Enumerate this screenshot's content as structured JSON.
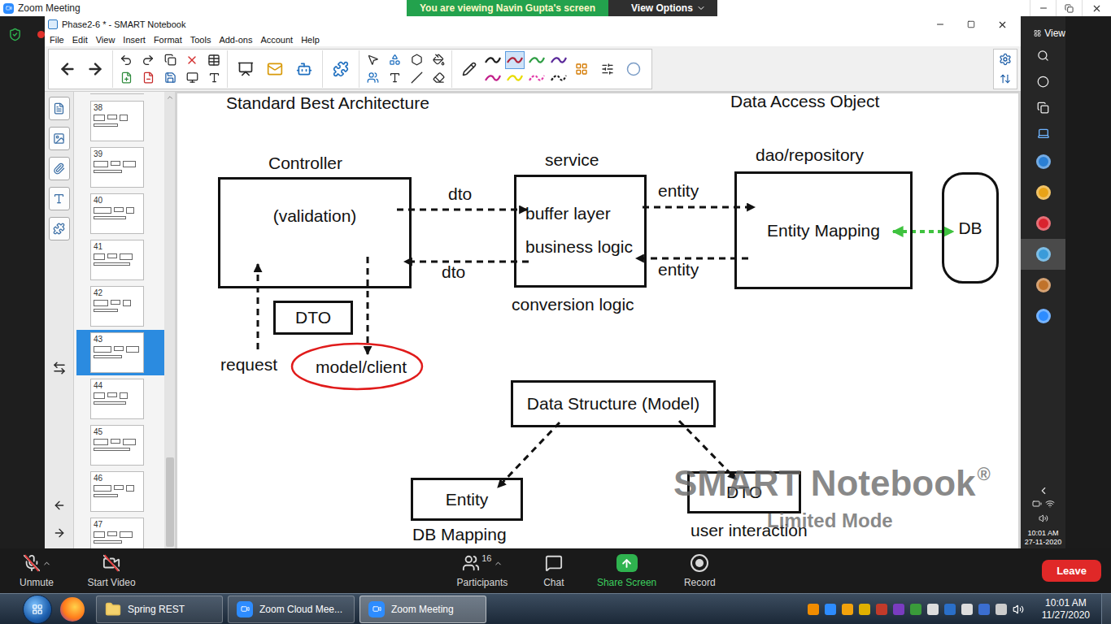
{
  "zoom_title_bar": {
    "title": "Zoom Meeting",
    "banner": "You are viewing Navin Gupta's screen",
    "view_options": "View Options"
  },
  "app": {
    "title": "Phase2-6 * - SMART Notebook",
    "menu": [
      "File",
      "Edit",
      "View",
      "Insert",
      "Format",
      "Tools",
      "Add-ons",
      "Account",
      "Help"
    ]
  },
  "pens": [
    {
      "color": "#1e1e1e",
      "kind": "solid",
      "selected": false
    },
    {
      "color": "#b0243a",
      "kind": "solid",
      "selected": true
    },
    {
      "color": "#2f9e44",
      "kind": "solid",
      "selected": false
    },
    {
      "color": "#5b2a9a",
      "kind": "solid",
      "selected": false
    },
    {
      "color": "#c21f8a",
      "kind": "solid",
      "selected": false
    },
    {
      "color": "#e8dc00",
      "kind": "solid",
      "selected": false
    },
    {
      "color": "#e23aa8",
      "kind": "dashed",
      "selected": false
    },
    {
      "color": "#1e1e1e",
      "kind": "dashed",
      "selected": false
    }
  ],
  "slides": [
    {
      "number": "38",
      "selected": false
    },
    {
      "number": "39",
      "selected": false
    },
    {
      "number": "40",
      "selected": false
    },
    {
      "number": "41",
      "selected": false
    },
    {
      "number": "42",
      "selected": false
    },
    {
      "number": "43",
      "selected": true
    },
    {
      "number": "44",
      "selected": false
    },
    {
      "number": "45",
      "selected": false
    },
    {
      "number": "46",
      "selected": false
    },
    {
      "number": "47",
      "selected": false
    }
  ],
  "diagram": {
    "title": "Standard Best Architecture",
    "subtitle": "Data Access Object",
    "controller": {
      "label": "Controller",
      "body": "(validation)"
    },
    "service": {
      "label": "service",
      "lines": [
        "buffer layer",
        "business logic"
      ],
      "caption": "conversion logic"
    },
    "dao": {
      "label": "dao/repository",
      "body": "Entity Mapping"
    },
    "db": "DB",
    "flows": [
      "dto",
      "dto",
      "entity",
      "entity"
    ],
    "dto": "DTO",
    "request": "request",
    "client": {
      "label": "model/client",
      "circled": true
    },
    "model": {
      "label": "Data Structure (Model)",
      "children": [
        {
          "label": "Entity",
          "caption": "DB Mapping"
        },
        {
          "label": "DTO",
          "caption": "user interaction"
        }
      ]
    }
  },
  "watermark": {
    "brand": "SMART Notebook",
    "mark": "®",
    "mode": "Limited Mode"
  },
  "windows_sidebar": {
    "view": "View",
    "apps": [
      {
        "color": "#2a7fd4",
        "selected": false
      },
      {
        "color": "#e8a317",
        "selected": false
      },
      {
        "color": "#d9232e",
        "selected": false
      },
      {
        "color": "#3a9bd9",
        "selected": true
      },
      {
        "color": "#c0722a",
        "selected": false
      },
      {
        "color": "#2d8cff",
        "selected": false
      }
    ],
    "time": "10:01 AM",
    "date": "27-11-2020"
  },
  "zoom_toolbar": {
    "items": [
      {
        "label": "Unmute",
        "kind": "mic",
        "off": true
      },
      {
        "label": "Start Video",
        "kind": "video",
        "off": true
      },
      {
        "label": "Participants",
        "kind": "participants",
        "off": false,
        "count": "16"
      },
      {
        "label": "Chat",
        "kind": "chat",
        "off": false
      },
      {
        "label": "Share Screen",
        "kind": "share",
        "off": false
      },
      {
        "label": "Record",
        "kind": "record",
        "off": false
      }
    ],
    "leave": "Leave"
  },
  "taskbar": {
    "buttons": [
      {
        "label": "Spring REST",
        "kind": "folder",
        "selected": false
      },
      {
        "label": "Zoom Cloud Mee...",
        "kind": "zoom",
        "selected": false
      },
      {
        "label": "Zoom Meeting",
        "kind": "zoom",
        "selected": true
      }
    ],
    "time": "10:01 AM",
    "date": "11/27/2020"
  }
}
